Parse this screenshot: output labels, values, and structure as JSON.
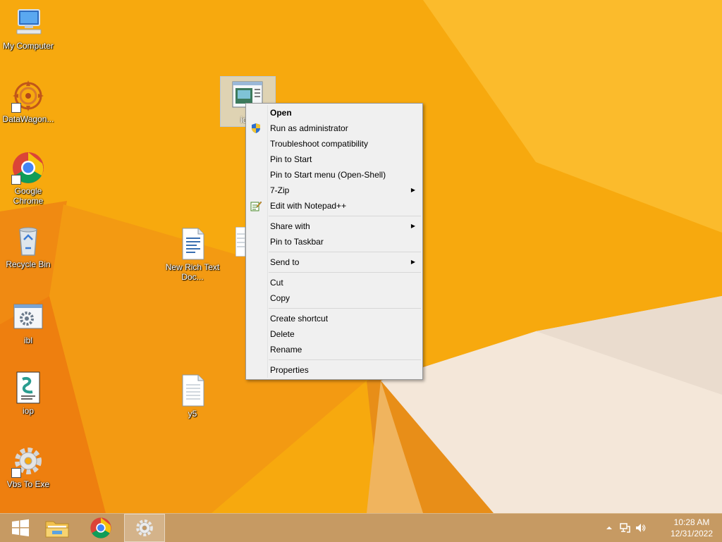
{
  "desktop": {
    "icons": [
      {
        "label": "My Computer",
        "icon": "computer-icon"
      },
      {
        "label": "DataWagon...",
        "icon": "datawagon-icon"
      },
      {
        "label": "Google Chrome",
        "icon": "chrome-icon"
      },
      {
        "label": "Recycle Bin",
        "icon": "recycle-bin-icon"
      },
      {
        "label": "ibl",
        "icon": "gear-file-icon"
      },
      {
        "label": "iop",
        "icon": "script-file-icon"
      },
      {
        "label": "Vbs To Exe",
        "icon": "gear-icon"
      },
      {
        "label": "New Rich Text Doc...",
        "icon": "rtf-document-icon"
      },
      {
        "label": "y5",
        "icon": "text-file-icon"
      }
    ],
    "selected_icon_label_fragment": "io"
  },
  "context_menu": {
    "items": [
      {
        "label": "Open",
        "bold": true
      },
      {
        "label": "Run as administrator",
        "icon": "uac-shield-icon"
      },
      {
        "label": "Troubleshoot compatibility"
      },
      {
        "label": "Pin to Start"
      },
      {
        "label": "Pin to Start menu (Open-Shell)"
      },
      {
        "label": "7-Zip",
        "submenu": true
      },
      {
        "label": "Edit with Notepad++",
        "icon": "notepadpp-icon"
      },
      {
        "label": "Share with",
        "submenu": true
      },
      {
        "label": "Pin to Taskbar"
      },
      {
        "label": "Send to",
        "submenu": true
      },
      {
        "label": "Cut"
      },
      {
        "label": "Copy"
      },
      {
        "label": "Create shortcut"
      },
      {
        "label": "Delete"
      },
      {
        "label": "Rename"
      },
      {
        "label": "Properties"
      }
    ]
  },
  "taskbar": {
    "buttons": [
      {
        "name": "start",
        "icon": "windows-logo-icon"
      },
      {
        "name": "file-explorer",
        "icon": "folder-icon"
      },
      {
        "name": "chrome",
        "icon": "chrome-icon"
      },
      {
        "name": "vbs-to-exe",
        "icon": "gear-icon",
        "active": true
      }
    ],
    "tray": {
      "icons": [
        "chevron-up-icon",
        "network-icon",
        "speaker-icon"
      ],
      "time": "10:28 AM",
      "date": "12/31/2022"
    }
  },
  "colors": {
    "wallpaper": "#f7a90e",
    "taskbar": "#c69a63",
    "menu_bg": "#f0f0f0"
  }
}
